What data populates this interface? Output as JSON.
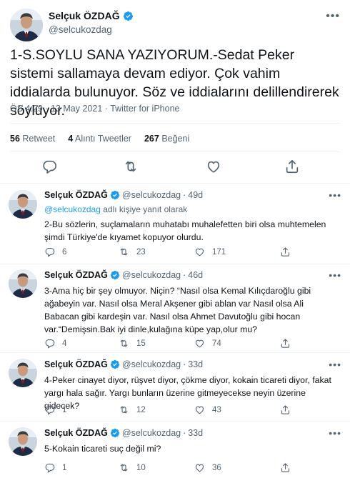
{
  "main_tweet": {
    "author_name": "Selçuk ÖZDAĞ",
    "author_handle": "@selcukozdag",
    "text": "1-S.SOYLU SANA YAZIYORUM.-Sedat Peker sistemi sallamaya devam ediyor. Çok vahim iddialarda bulunuyor. Söz ve iddialarını delillendirerek söylüyor.",
    "time": "ÖS 4:29",
    "date": "13 May 2021",
    "source": "Twitter for iPhone",
    "separator": "·",
    "stats": {
      "retweets": "56",
      "retweets_label": "Retweet",
      "quotes": "4",
      "quotes_label": "Alıntı Tweetler",
      "likes": "267",
      "likes_label": "Beğeni"
    }
  },
  "replies": [
    {
      "name": "Selçuk ÖZDAĞ",
      "handle": "@selcukozdag",
      "dot": "·",
      "time": "49d",
      "reply_to_mention": "@selcukozdag",
      "reply_to_suffix": " adlı kişiye yanıt olarak",
      "text": "2-Bu sözlerin, suçlamaların muhatabı muhalefetten biri olsa muhtemelen şimdi Türkiye'de kıyamet kopuyor olurdu.",
      "replies": "6",
      "retweets": "23",
      "likes": "171"
    },
    {
      "name": "Selçuk ÖZDAĞ",
      "handle": "@selcukozdag",
      "dot": "·",
      "time": "46d",
      "text": "3-Ama hiç bir şey olmuyor. Niçin? “Nasıl olsa Kemal Kılıçdaroğlu gibi ağabeyin var. Nasıl olsa Meral Akşener gibi ablan var Nasıl olsa Ali Babacan gibi kardeşin var. Nasıl olsa Ahmet Davutoğlu gibi hocan var.“Demişsin.Bak iyi dinle,kulağına küpe yap,olur mu?",
      "replies": "4",
      "retweets": "15",
      "likes": "74"
    },
    {
      "name": "Selçuk ÖZDAĞ",
      "handle": "@selcukozdag",
      "dot": "·",
      "time": "33d",
      "text": "4-Peker cinayet diyor, rüşvet diyor, çökme diyor, kokain ticareti diyor, fakat yargı hala sağır. Yargı bunların üzerine gitmeyecekse neyin üzerine gidecek?",
      "replies": "1",
      "retweets": "12",
      "likes": "43"
    },
    {
      "name": "Selçuk ÖZDAĞ",
      "handle": "@selcukozdag",
      "dot": "·",
      "time": "33d",
      "text": "5-Kokain ticareti suç değil mi?",
      "replies": "1",
      "retweets": "10",
      "likes": "36"
    }
  ],
  "icons": {
    "verified": "verified-badge-icon",
    "more": "more-icon",
    "reply": "reply-icon",
    "retweet": "retweet-icon",
    "like": "like-icon",
    "share": "share-icon"
  },
  "colors": {
    "accent": "#1d9bf0",
    "secondary_text": "#536471",
    "primary_text": "#0f1419",
    "divider": "#eff3f4"
  }
}
